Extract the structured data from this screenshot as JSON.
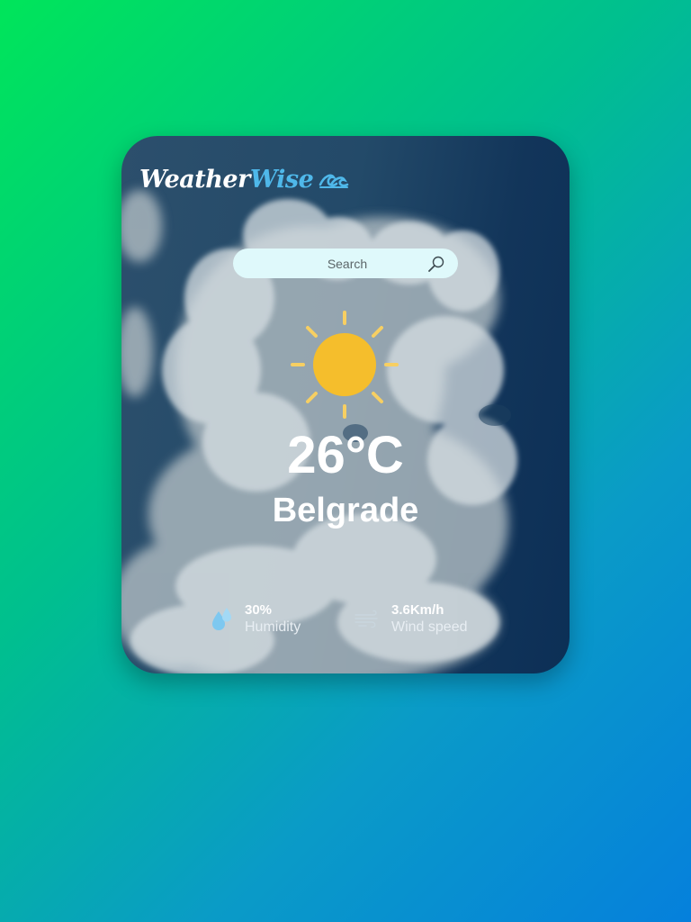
{
  "app": {
    "brand_part1": "Weather",
    "brand_part2": "Wise",
    "brand_icon": "wave-icon"
  },
  "search": {
    "placeholder": "Search",
    "icon": "magnifier-icon"
  },
  "weather": {
    "icon": "sun-icon",
    "temperature": "26°C",
    "city": "Belgrade"
  },
  "details": {
    "humidity": {
      "value": "30%",
      "label": "Humidity",
      "icon": "water-drops-icon"
    },
    "wind": {
      "value": "3.6Km/h",
      "label": "Wind speed",
      "icon": "wind-icon"
    }
  },
  "colors": {
    "background_gradient_start": "#00e55a",
    "background_gradient_end": "#0580dc",
    "sun": "#f5be2c",
    "sun_rays": "#f7cf62",
    "search_bg": "#dff9fb",
    "brand_accent": "#4fb8ea"
  }
}
